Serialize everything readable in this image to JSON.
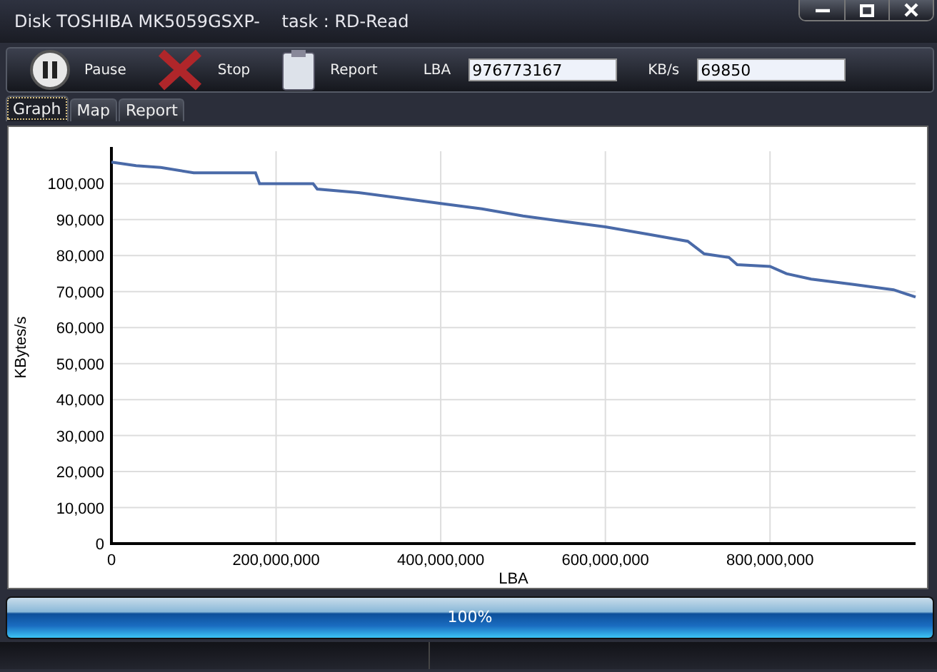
{
  "window": {
    "title": "Disk TOSHIBA MK5059GSXP-    task : RD-Read"
  },
  "toolbar": {
    "buttons": [
      {
        "kind": "pause",
        "label": "Pause"
      },
      {
        "kind": "stop",
        "label": "Stop"
      },
      {
        "kind": "report",
        "label": "Report"
      }
    ],
    "fields": [
      {
        "label": "LBA",
        "value": "976773167"
      },
      {
        "label": "KB/s",
        "value": "69850"
      }
    ]
  },
  "tabs": [
    {
      "label": "Graph",
      "selected": true
    },
    {
      "label": "Map",
      "selected": false
    },
    {
      "label": "Report",
      "selected": false
    }
  ],
  "graph": {
    "chart_data": {
      "type": "line",
      "xlabel": "LBA",
      "ylabel": "KBytes/s",
      "xlim": [
        0,
        976773167
      ],
      "ylim": [
        0,
        109000
      ],
      "xticks": [
        {
          "value": 0,
          "label": "0"
        },
        {
          "value": 200000000,
          "label": "200,000,000"
        },
        {
          "value": 400000000,
          "label": "400,000,000"
        },
        {
          "value": 600000000,
          "label": "600,000,000"
        },
        {
          "value": 800000000,
          "label": "800,000,000"
        }
      ],
      "yticks": [
        {
          "value": 0,
          "label": "0"
        },
        {
          "value": 10000,
          "label": "10,000"
        },
        {
          "value": 20000,
          "label": "20,000"
        },
        {
          "value": 30000,
          "label": "30,000"
        },
        {
          "value": 40000,
          "label": "40,000"
        },
        {
          "value": 50000,
          "label": "50,000"
        },
        {
          "value": 60000,
          "label": "60,000"
        },
        {
          "value": 70000,
          "label": "70,000"
        },
        {
          "value": 80000,
          "label": "80,000"
        },
        {
          "value": 90000,
          "label": "90,000"
        },
        {
          "value": 100000,
          "label": "100,000"
        }
      ],
      "x": [
        0,
        30000000,
        60000000,
        100000000,
        175000000,
        180000000,
        245000000,
        250000000,
        300000000,
        350000000,
        400000000,
        450000000,
        500000000,
        550000000,
        600000000,
        650000000,
        700000000,
        720000000,
        750000000,
        760000000,
        800000000,
        820000000,
        850000000,
        900000000,
        950000000,
        976773167
      ],
      "grid": true,
      "series": [
        {
          "color": "#4a6aa8",
          "values": [
            106000,
            105000,
            104500,
            103000,
            103000,
            100000,
            100000,
            98500,
            97500,
            96000,
            94500,
            93000,
            91000,
            89500,
            88000,
            86000,
            84000,
            80500,
            79500,
            77500,
            77000,
            75000,
            73500,
            72000,
            70500,
            68500
          ]
        }
      ]
    }
  },
  "progress": {
    "level": 1,
    "reading": "100%"
  }
}
